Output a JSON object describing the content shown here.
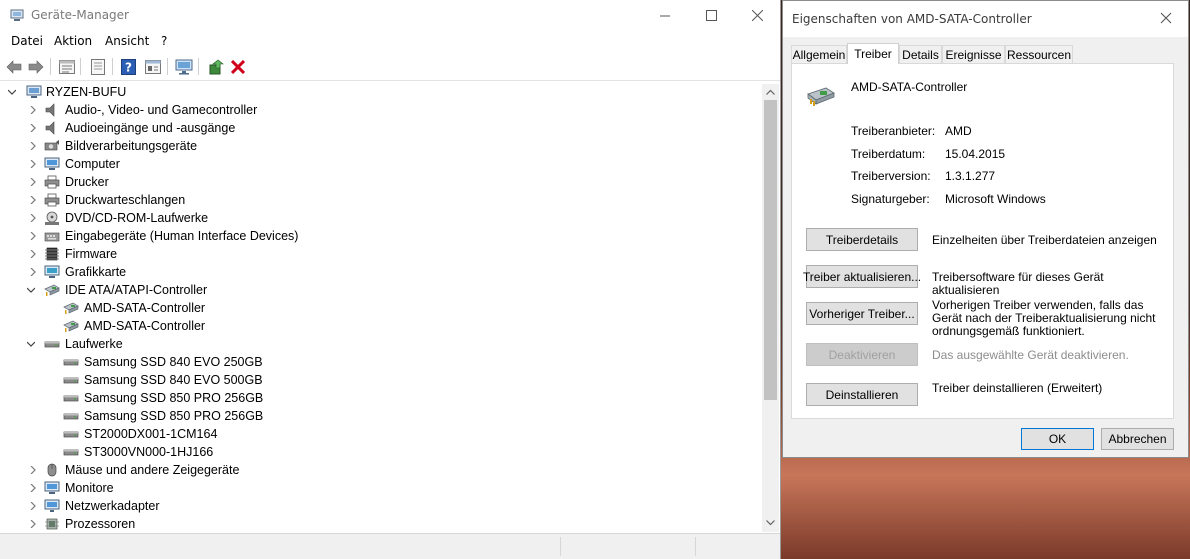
{
  "device_manager": {
    "title": "Geräte-Manager",
    "menu": [
      "Datei",
      "Aktion",
      "Ansicht",
      "?"
    ],
    "toolbar_icons": [
      "back-icon",
      "forward-icon",
      "properties-list-icon",
      "view-icon",
      "help-icon",
      "view-resources-icon",
      "scan-hardware-icon",
      "update-driver-icon",
      "uninstall-icon"
    ],
    "tree": {
      "root": "RYZEN-BUFU",
      "items": [
        {
          "label": "Audio-, Video- und Gamecontroller",
          "level": 1,
          "expander": "collapsed",
          "icon": "speaker-icon"
        },
        {
          "label": "Audioeingänge und -ausgänge",
          "level": 1,
          "expander": "collapsed",
          "icon": "speaker-icon"
        },
        {
          "label": "Bildverarbeitungsgeräte",
          "level": 1,
          "expander": "collapsed",
          "icon": "camera-icon"
        },
        {
          "label": "Computer",
          "level": 1,
          "expander": "collapsed",
          "icon": "monitor-icon"
        },
        {
          "label": "Drucker",
          "level": 1,
          "expander": "collapsed",
          "icon": "printer-icon"
        },
        {
          "label": "Druckwarteschlangen",
          "level": 1,
          "expander": "collapsed",
          "icon": "printer-icon"
        },
        {
          "label": "DVD/CD-ROM-Laufwerke",
          "level": 1,
          "expander": "collapsed",
          "icon": "disc-drive-icon"
        },
        {
          "label": "Eingabegeräte (Human Interface Devices)",
          "level": 1,
          "expander": "collapsed",
          "icon": "hid-icon"
        },
        {
          "label": "Firmware",
          "level": 1,
          "expander": "collapsed",
          "icon": "chip-icon"
        },
        {
          "label": "Grafikkarte",
          "level": 1,
          "expander": "collapsed",
          "icon": "display-adapter-icon"
        },
        {
          "label": "IDE ATA/ATAPI-Controller",
          "level": 1,
          "expander": "expanded",
          "icon": "controller-icon"
        },
        {
          "label": "AMD-SATA-Controller",
          "level": 2,
          "expander": "none",
          "icon": "controller-icon"
        },
        {
          "label": "AMD-SATA-Controller",
          "level": 2,
          "expander": "none",
          "icon": "controller-icon"
        },
        {
          "label": "Laufwerke",
          "level": 1,
          "expander": "expanded",
          "icon": "drive-icon"
        },
        {
          "label": "Samsung SSD 840 EVO 250GB",
          "level": 2,
          "expander": "none",
          "icon": "drive-icon"
        },
        {
          "label": "Samsung SSD 840 EVO 500GB",
          "level": 2,
          "expander": "none",
          "icon": "drive-icon"
        },
        {
          "label": "Samsung SSD 850 PRO 256GB",
          "level": 2,
          "expander": "none",
          "icon": "drive-icon"
        },
        {
          "label": "Samsung SSD 850 PRO 256GB",
          "level": 2,
          "expander": "none",
          "icon": "drive-icon"
        },
        {
          "label": "ST2000DX001-1CM164",
          "level": 2,
          "expander": "none",
          "icon": "drive-icon"
        },
        {
          "label": "ST3000VN000-1HJ166",
          "level": 2,
          "expander": "none",
          "icon": "drive-icon"
        },
        {
          "label": "Mäuse und andere Zeigegeräte",
          "level": 1,
          "expander": "collapsed",
          "icon": "mouse-icon"
        },
        {
          "label": "Monitore",
          "level": 1,
          "expander": "collapsed",
          "icon": "monitor-icon"
        },
        {
          "label": "Netzwerkadapter",
          "level": 1,
          "expander": "collapsed",
          "icon": "network-icon"
        },
        {
          "label": "Prozessoren",
          "level": 1,
          "expander": "collapsed",
          "icon": "cpu-icon"
        }
      ]
    }
  },
  "properties_dialog": {
    "title": "Eigenschaften von AMD-SATA-Controller",
    "tabs": [
      "Allgemein",
      "Treiber",
      "Details",
      "Ereignisse",
      "Ressourcen"
    ],
    "active_tab": "Treiber",
    "device_name": "AMD-SATA-Controller",
    "info": [
      {
        "key": "Treiberanbieter:",
        "value": "AMD"
      },
      {
        "key": "Treiberdatum:",
        "value": "15.04.2015"
      },
      {
        "key": "Treiberversion:",
        "value": "1.3.1.277"
      },
      {
        "key": "Signaturgeber:",
        "value": "Microsoft Windows"
      }
    ],
    "actions": [
      {
        "button": "Treiberdetails",
        "description": "Einzelheiten über Treiberdateien anzeigen",
        "enabled": true
      },
      {
        "button": "Treiber aktualisieren...",
        "description": "Treibersoftware für dieses Gerät aktualisieren",
        "enabled": true
      },
      {
        "button": "Vorheriger Treiber...",
        "description": "Vorherigen Treiber verwenden, falls das Gerät nach der Treiberaktualisierung nicht ordnungsgemäß funktioniert.",
        "enabled": true
      },
      {
        "button": "Deaktivieren",
        "description": "Das ausgewählte Gerät deaktivieren.",
        "enabled": false
      },
      {
        "button": "Deinstallieren",
        "description": "Treiber deinstallieren (Erweitert)",
        "enabled": true
      }
    ],
    "ok_label": "OK",
    "cancel_label": "Abbrechen"
  }
}
